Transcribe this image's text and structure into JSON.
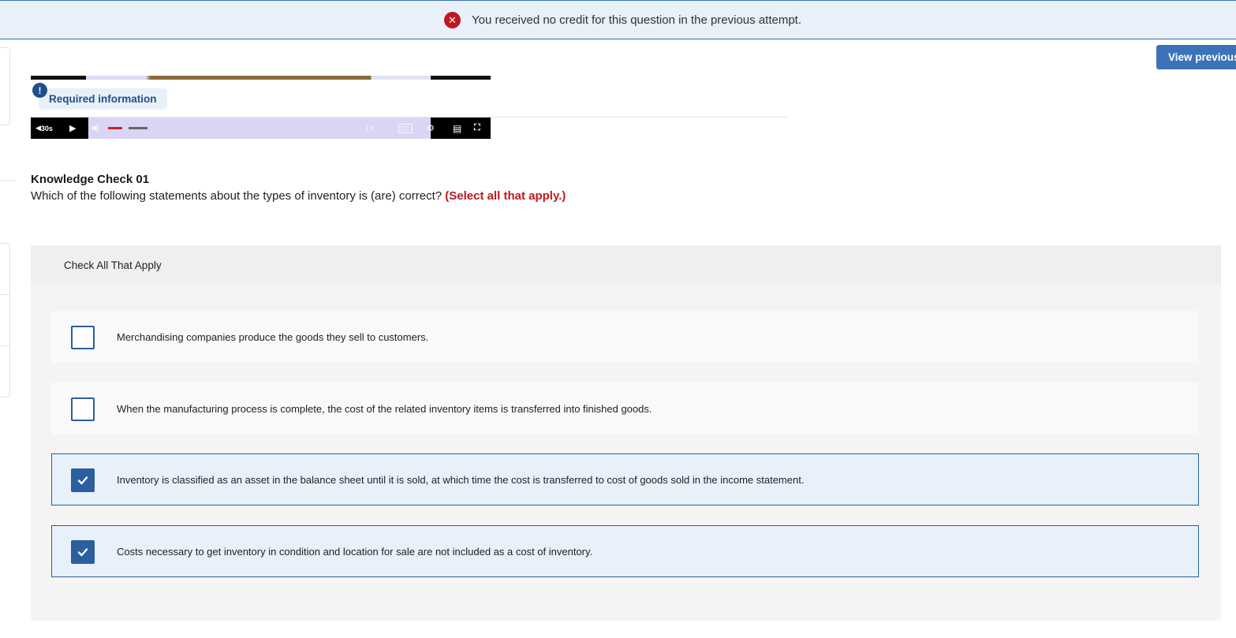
{
  "banner": {
    "message": "You received no credit for this question in the previous attempt.",
    "icon": "error-x-icon"
  },
  "actions": {
    "view_previous_label": "View previous"
  },
  "video": {
    "required_info_label": "Required information",
    "badge": "!",
    "controls": {
      "skip_back_label": "30s",
      "speed_label": "1X",
      "cc_label": "CC"
    }
  },
  "question": {
    "title": "Knowledge Check 01",
    "prompt": "Which of the following statements about the types of inventory is (are) correct?",
    "hint": "(Select all that apply.)"
  },
  "answers": {
    "header": "Check All That Apply",
    "options": [
      {
        "text": "Merchandising companies produce the goods they sell to customers.",
        "checked": false
      },
      {
        "text": "When the manufacturing process is complete, the cost of the related inventory items is transferred into finished goods.",
        "checked": false
      },
      {
        "text": "Inventory is classified as an asset in the balance sheet until it is sold, at which time the cost is transferred to cost of goods sold in the income statement.",
        "checked": true
      },
      {
        "text": "Costs necessary to get inventory in condition and location for sale are not included as a cost of inventory.",
        "checked": true
      }
    ]
  },
  "colors": {
    "accent": "#2b5f9e",
    "error": "#c0171f",
    "banner_bg": "#e8f0f9"
  }
}
